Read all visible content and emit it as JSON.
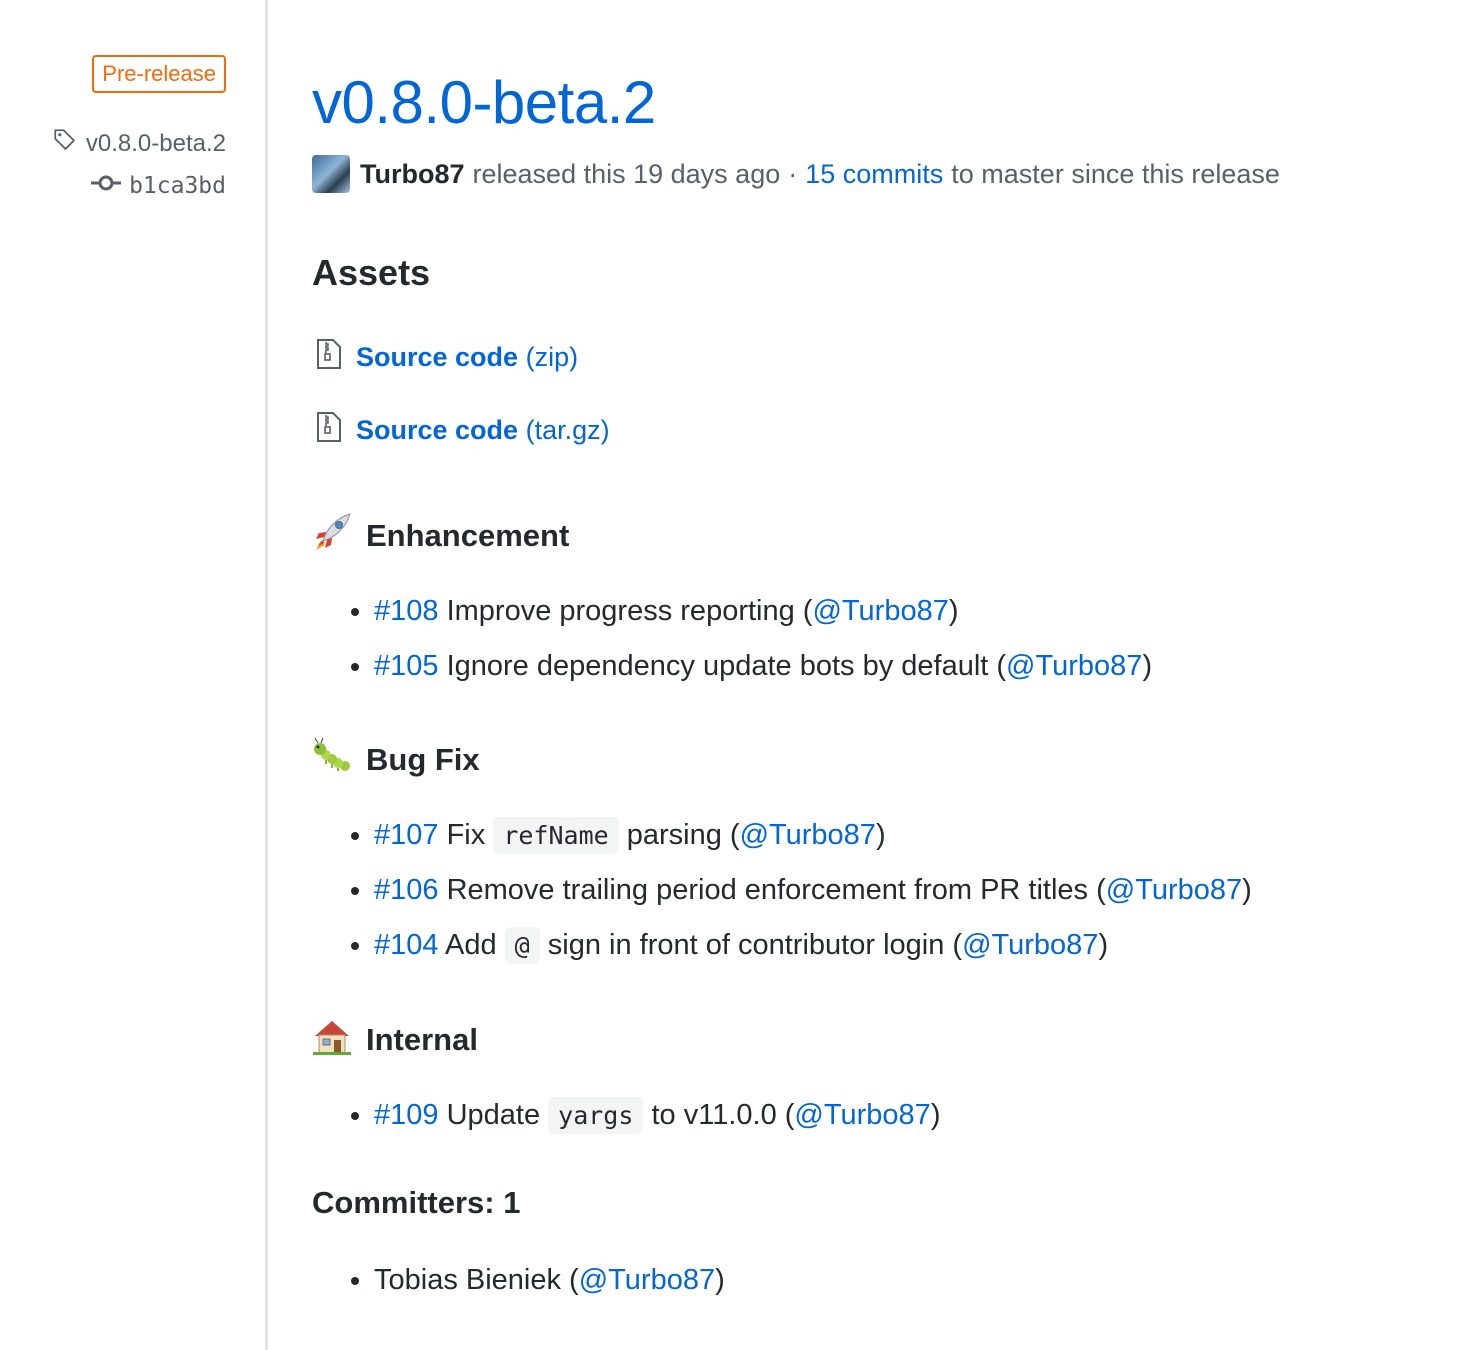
{
  "sidebar": {
    "badge": "Pre-release",
    "tag": "v0.8.0-beta.2",
    "commit": "b1ca3bd"
  },
  "release": {
    "title": "v0.8.0-beta.2",
    "author": "Turbo87",
    "released_text": "released this 19 days ago",
    "separator": "·",
    "commits_link": "15 commits",
    "commits_suffix": "to master since this release"
  },
  "assets": {
    "heading": "Assets",
    "items": [
      {
        "label": "Source code",
        "ext": "(zip)"
      },
      {
        "label": "Source code",
        "ext": "(tar.gz)"
      }
    ]
  },
  "sections": {
    "enhancement": {
      "heading": "Enhancement",
      "items": [
        {
          "pr": "#108",
          "pre": "Improve progress reporting (",
          "user": "@Turbo87",
          "post": ")"
        },
        {
          "pr": "#105",
          "pre": "Ignore dependency update bots by default (",
          "user": "@Turbo87",
          "post": ")"
        }
      ]
    },
    "bugfix": {
      "heading": "Bug Fix",
      "items": [
        {
          "pr": "#107",
          "pre": "Fix",
          "code": "refName",
          "mid": "parsing (",
          "user": "@Turbo87",
          "post": ")"
        },
        {
          "pr": "#106",
          "pre": "Remove trailing period enforcement from PR titles (",
          "user": "@Turbo87",
          "post": ")"
        },
        {
          "pr": "#104",
          "pre": "Add",
          "code": "@",
          "mid": "sign in front of contributor login (",
          "user": "@Turbo87",
          "post": ")"
        }
      ]
    },
    "internal": {
      "heading": "Internal",
      "items": [
        {
          "pr": "#109",
          "pre": "Update",
          "code": "yargs",
          "mid": "to v11.0.0 (",
          "user": "@Turbo87",
          "post": ")"
        }
      ]
    },
    "committers": {
      "heading": "Committers: 1",
      "items": [
        {
          "name": "Tobias Bieniek (",
          "user": "@Turbo87",
          "post": ")"
        }
      ]
    }
  },
  "colors": {
    "link": "#0366d6",
    "badge": "#f66a0a",
    "text": "#24292e",
    "muted": "#586069"
  }
}
